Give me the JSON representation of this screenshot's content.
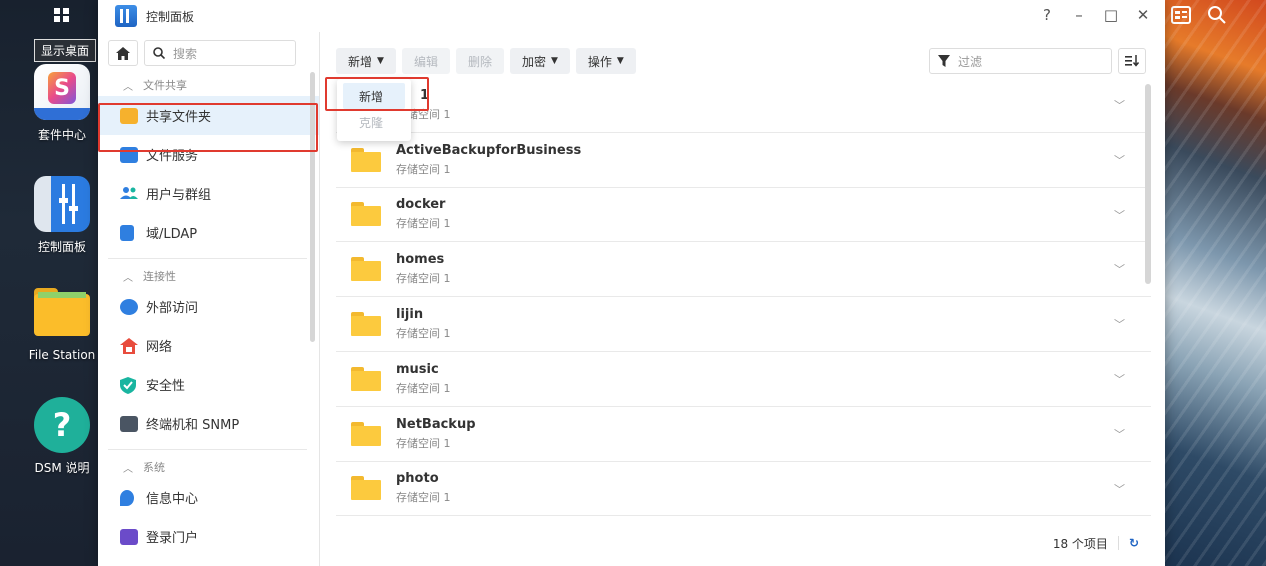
{
  "desktop": {
    "show_desktop_tooltip": "显示桌面",
    "icons": [
      {
        "label": "套件中心"
      },
      {
        "label": "控制面板"
      },
      {
        "label": "File Station"
      },
      {
        "label": "DSM 说明"
      }
    ]
  },
  "window": {
    "title": "控制面板",
    "controls": {
      "help": "?",
      "minimize": "–",
      "maximize": "□",
      "close": "✕"
    }
  },
  "sidebar": {
    "search_placeholder": "搜索",
    "groups": [
      {
        "label": "文件共享",
        "items": [
          "共享文件夹",
          "文件服务",
          "用户与群组",
          "域/LDAP"
        ]
      },
      {
        "label": "连接性",
        "items": [
          "外部访问",
          "网络",
          "安全性",
          "终端机和 SNMP"
        ]
      },
      {
        "label": "系统",
        "items": [
          "信息中心",
          "登录门户"
        ]
      }
    ]
  },
  "toolbar": {
    "create": "新增",
    "edit": "编辑",
    "delete": "删除",
    "encrypt": "加密",
    "action": "操作",
    "filter_placeholder": "过滤"
  },
  "dropdown": {
    "options": [
      "新增",
      "克隆"
    ]
  },
  "folders": [
    {
      "name": "1",
      "volume": "存储空间 1"
    },
    {
      "name": "ActiveBackupforBusiness",
      "volume": "存储空间 1"
    },
    {
      "name": "docker",
      "volume": "存储空间 1"
    },
    {
      "name": "homes",
      "volume": "存储空间 1"
    },
    {
      "name": "lijin",
      "volume": "存储空间 1"
    },
    {
      "name": "music",
      "volume": "存储空间 1"
    },
    {
      "name": "NetBackup",
      "volume": "存储空间 1"
    },
    {
      "name": "photo",
      "volume": "存储空间 1"
    }
  ],
  "footer": {
    "count": "18 个项目"
  },
  "colors": {
    "accent": "#1f64c3",
    "annotation": "#e03a2f",
    "active_bg": "#e6f1fb"
  }
}
